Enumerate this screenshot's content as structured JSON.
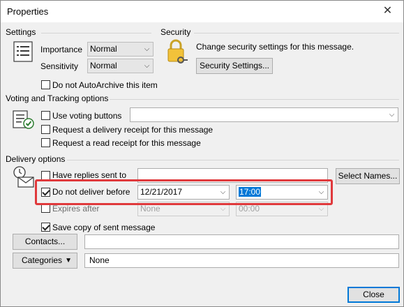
{
  "window": {
    "title": "Properties",
    "close_glyph": "✕"
  },
  "settings": {
    "section_title": "Settings",
    "importance_label": "Importance",
    "importance_value": "Normal",
    "sensitivity_label": "Sensitivity",
    "sensitivity_value": "Normal",
    "autoarchive_label": "Do not AutoArchive this item"
  },
  "security": {
    "section_title": "Security",
    "description": "Change security settings for this message.",
    "button_label": "Security Settings..."
  },
  "voting": {
    "section_title": "Voting and Tracking options",
    "voting_label": "Use voting buttons",
    "voting_value": "",
    "delivery_receipt_label": "Request a delivery receipt for this message",
    "read_receipt_label": "Request a read receipt for this message"
  },
  "delivery": {
    "section_title": "Delivery options",
    "replies_label": "Have replies sent to",
    "replies_value": "",
    "select_names_label": "Select Names...",
    "deliver_before_label": "Do not deliver before",
    "deliver_date": "12/21/2017",
    "deliver_time": "17:00",
    "expires_label": "Expires after",
    "expires_date": "None",
    "expires_time": "00:00",
    "save_copy_label": "Save copy of sent message"
  },
  "contacts": {
    "button_label": "Contacts...",
    "value": ""
  },
  "categories": {
    "button_label": "Categories",
    "value": "None"
  },
  "footer": {
    "close_label": "Close"
  },
  "colors": {
    "highlight": "#e0393c",
    "accent": "#0078d7"
  }
}
